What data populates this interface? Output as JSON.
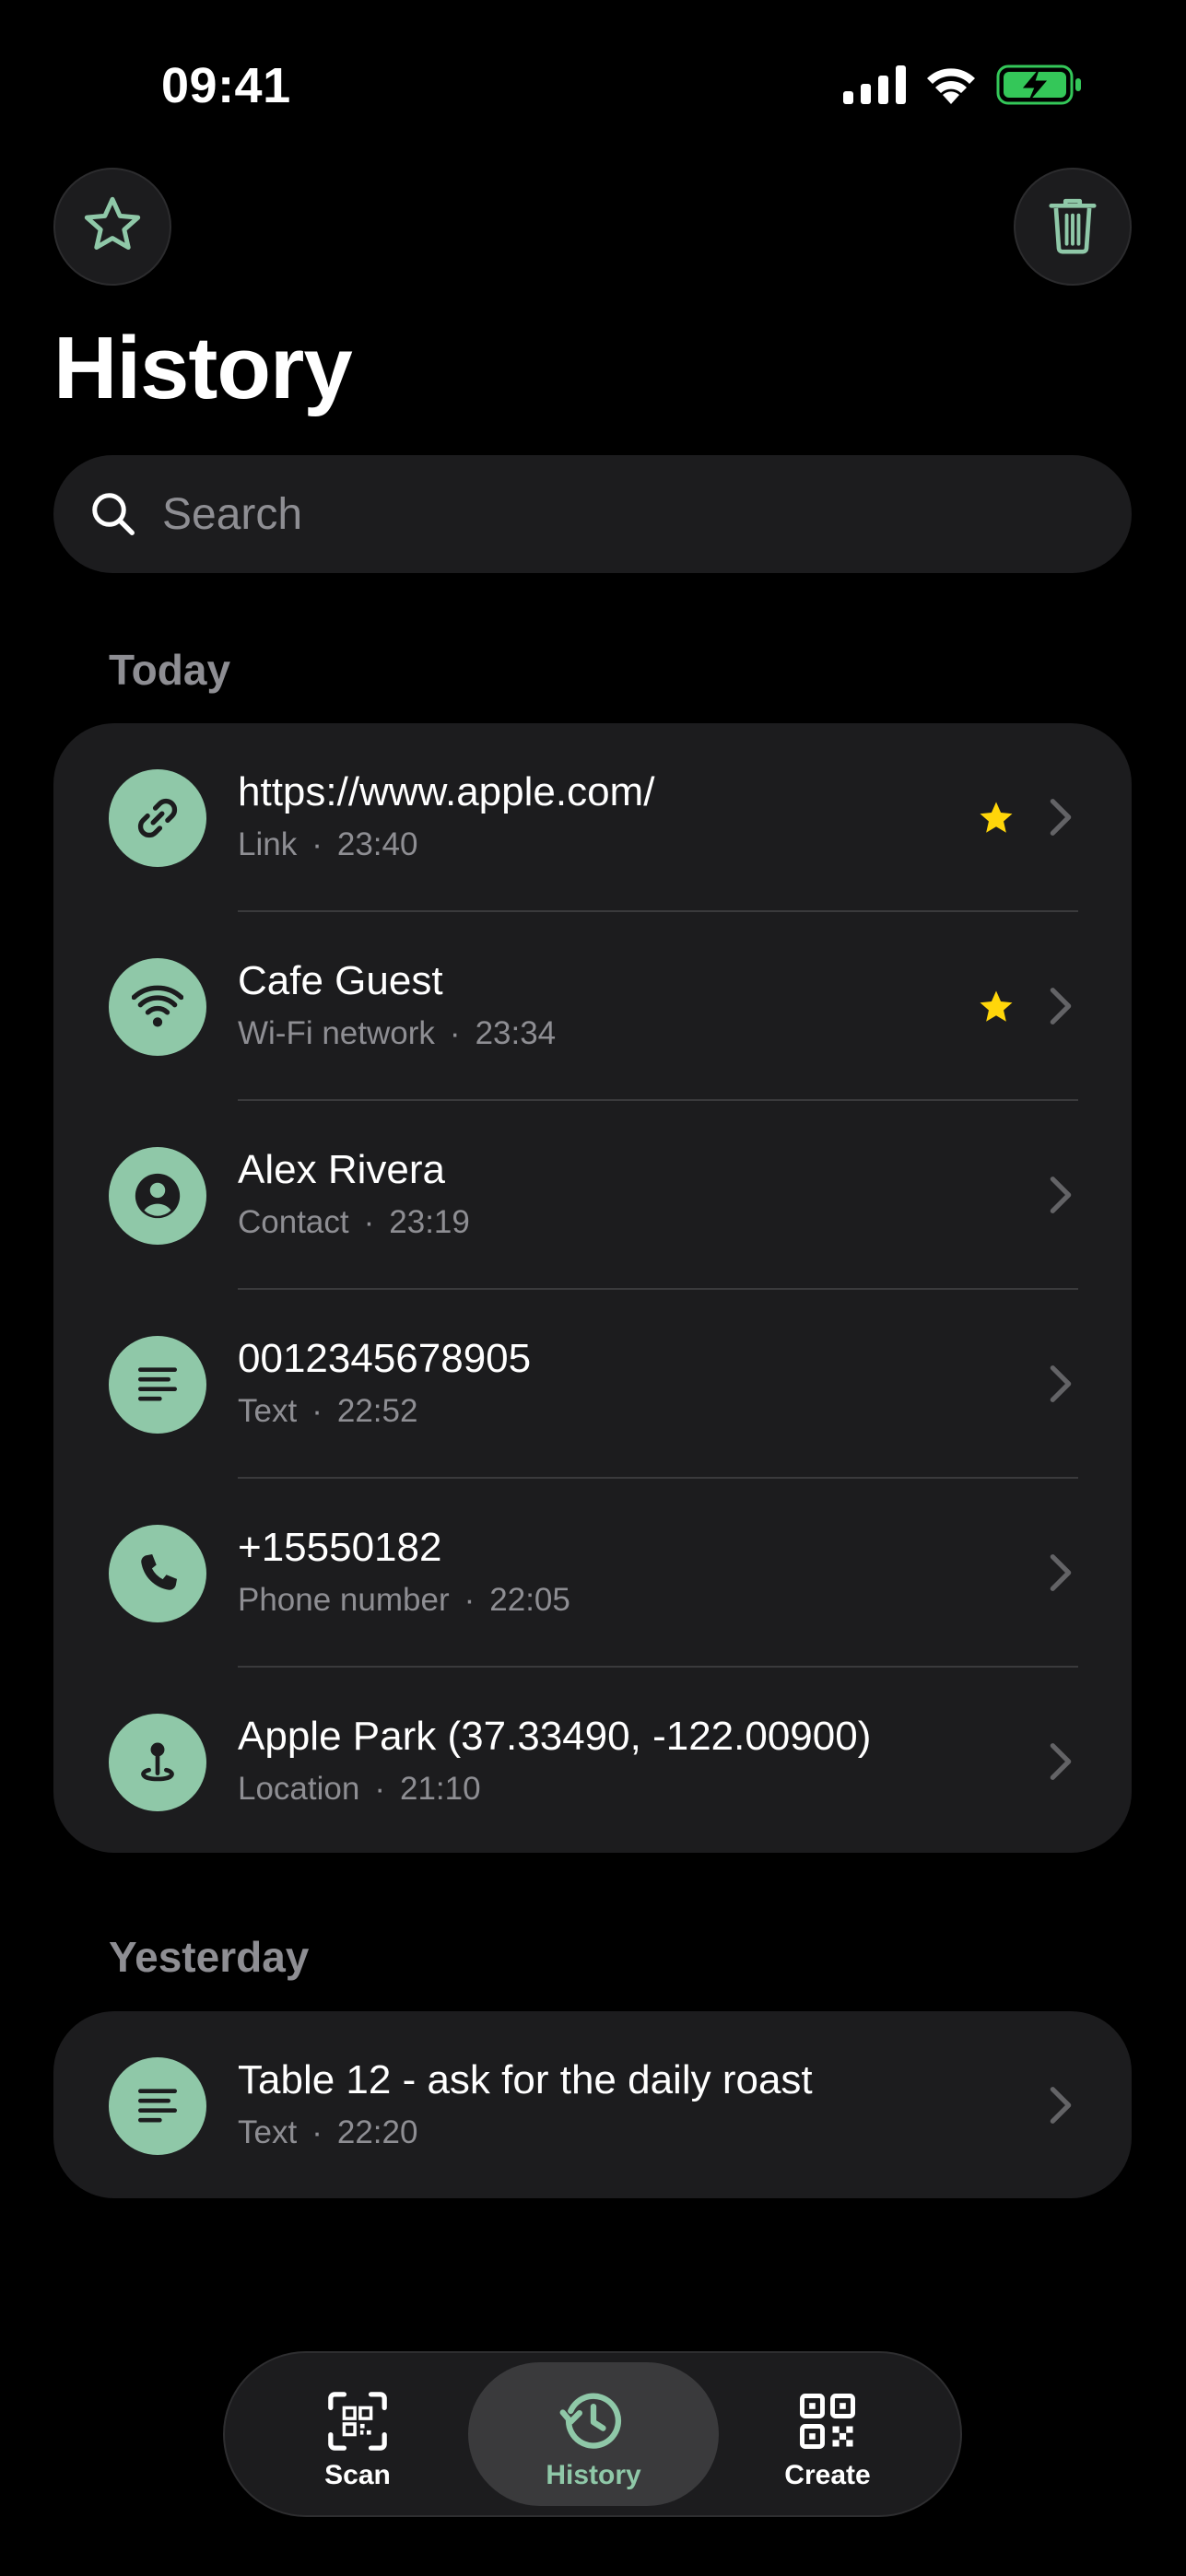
{
  "status_bar": {
    "time": "09:41"
  },
  "colors": {
    "accent": "#8fc8a8",
    "star": "#ffd60a",
    "card": "#1c1c1e",
    "secondary_text": "#8e8e93",
    "battery": "#34c759"
  },
  "header": {
    "favorites_icon": "star-outline-icon",
    "trash_icon": "trash-icon",
    "title": "History"
  },
  "search": {
    "placeholder": "Search"
  },
  "sections": [
    {
      "title": "Today",
      "items": [
        {
          "icon": "link-icon",
          "title": "https://www.apple.com/",
          "type": "Link",
          "time": "23:40",
          "starred": true
        },
        {
          "icon": "wifi-icon",
          "title": "Cafe Guest",
          "type": "Wi-Fi network",
          "time": "23:34",
          "starred": true
        },
        {
          "icon": "contact-icon",
          "title": "Alex Rivera",
          "type": "Contact",
          "time": "23:19",
          "starred": false
        },
        {
          "icon": "text-icon",
          "title": "0012345678905",
          "type": "Text",
          "time": "22:52",
          "starred": false
        },
        {
          "icon": "phone-icon",
          "title": "+15550182",
          "type": "Phone number",
          "time": "22:05",
          "starred": false
        },
        {
          "icon": "location-icon",
          "title": "Apple Park (37.33490, -122.00900)",
          "type": "Location",
          "time": "21:10",
          "starred": false
        }
      ]
    },
    {
      "title": "Yesterday",
      "items": [
        {
          "icon": "text-icon",
          "title": "Table 12 - ask for the daily roast",
          "type": "Text",
          "time": "22:20",
          "starred": false
        }
      ]
    }
  ],
  "tab_bar": {
    "tabs": [
      {
        "label": "Scan",
        "icon": "scan-qr-icon",
        "active": false
      },
      {
        "label": "History",
        "icon": "history-icon",
        "active": true
      },
      {
        "label": "Create",
        "icon": "qr-code-icon",
        "active": false
      }
    ]
  },
  "separator": "·"
}
